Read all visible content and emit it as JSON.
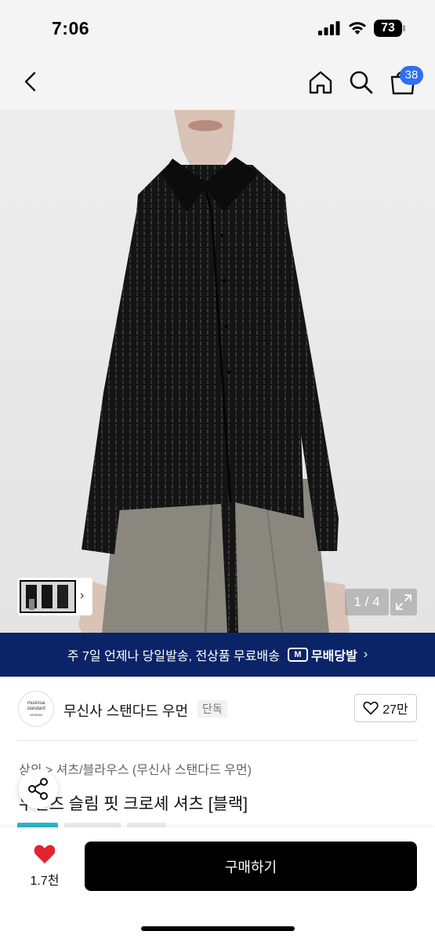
{
  "status_bar": {
    "time": "7:06",
    "battery": "73"
  },
  "nav": {
    "cart_count": "38"
  },
  "gallery": {
    "counter": "1 / 4",
    "thumb_arrow": "›"
  },
  "shipping": {
    "text": "주 7일 언제나 당일발송, 전상품 무료배송",
    "logo_mark": "M",
    "logo_text": "무배당발",
    "chevron": "›"
  },
  "brand": {
    "logo_line1": "musinsa",
    "logo_line2": "standard",
    "logo_line3": "WOMAN",
    "name": "무신사 스탠다드 우먼",
    "tag": "단독",
    "like_count": "27만"
  },
  "product": {
    "category": "상의 > 셔츠/블라우스 (무신사 스탠다드 우먼)",
    "title": "우먼즈 슬림 핏 크로셰 셔츠 [블랙]"
  },
  "bottom": {
    "wish_count": "1.7천",
    "buy_label": "구매하기"
  },
  "colors": {
    "banner_bg": "#0b2468",
    "badge_bg": "#2f6ff0",
    "heart": "#e5232f",
    "button_bg": "#000000"
  }
}
